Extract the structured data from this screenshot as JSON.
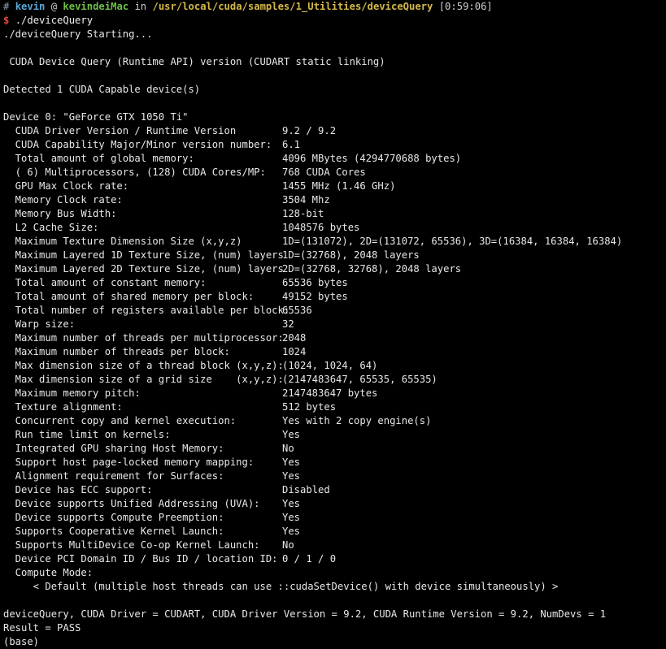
{
  "prompt": {
    "hash": "#",
    "user": "kevin",
    "at": "@",
    "host": "kevindeiMac",
    "in": "in",
    "path": "/usr/local/cuda/samples/1_Utilities/deviceQuery",
    "time": "[0:59:06]",
    "dollar": "$",
    "command": "./deviceQuery"
  },
  "header": {
    "starting": "./deviceQuery Starting...",
    "api_line": " CUDA Device Query (Runtime API) version (CUDART static linking)",
    "detected": "Detected 1 CUDA Capable device(s)",
    "device": "Device 0: \"GeForce GTX 1050 Ti\""
  },
  "properties": [
    {
      "key": "  CUDA Driver Version / Runtime Version",
      "value": "9.2 / 9.2"
    },
    {
      "key": "  CUDA Capability Major/Minor version number:",
      "value": "6.1"
    },
    {
      "key": "  Total amount of global memory:",
      "value": "4096 MBytes (4294770688 bytes)"
    },
    {
      "key": "  ( 6) Multiprocessors, (128) CUDA Cores/MP:",
      "value": "768 CUDA Cores"
    },
    {
      "key": "  GPU Max Clock rate:",
      "value": "1455 MHz (1.46 GHz)"
    },
    {
      "key": "  Memory Clock rate:",
      "value": "3504 Mhz"
    },
    {
      "key": "  Memory Bus Width:",
      "value": "128-bit"
    },
    {
      "key": "  L2 Cache Size:",
      "value": "1048576 bytes"
    },
    {
      "key": "  Maximum Texture Dimension Size (x,y,z)",
      "value": "1D=(131072), 2D=(131072, 65536), 3D=(16384, 16384, 16384)"
    },
    {
      "key": "  Maximum Layered 1D Texture Size, (num) layers",
      "value": "1D=(32768), 2048 layers"
    },
    {
      "key": "  Maximum Layered 2D Texture Size, (num) layers",
      "value": "2D=(32768, 32768), 2048 layers"
    },
    {
      "key": "  Total amount of constant memory:",
      "value": "65536 bytes"
    },
    {
      "key": "  Total amount of shared memory per block:",
      "value": "49152 bytes"
    },
    {
      "key": "  Total number of registers available per block:",
      "value": "65536"
    },
    {
      "key": "  Warp size:",
      "value": "32"
    },
    {
      "key": "  Maximum number of threads per multiprocessor:",
      "value": "2048"
    },
    {
      "key": "  Maximum number of threads per block:",
      "value": "1024"
    },
    {
      "key": "  Max dimension size of a thread block (x,y,z):",
      "value": "(1024, 1024, 64)"
    },
    {
      "key": "  Max dimension size of a grid size    (x,y,z):",
      "value": "(2147483647, 65535, 65535)"
    },
    {
      "key": "  Maximum memory pitch:",
      "value": "2147483647 bytes"
    },
    {
      "key": "  Texture alignment:",
      "value": "512 bytes"
    },
    {
      "key": "  Concurrent copy and kernel execution:",
      "value": "Yes with 2 copy engine(s)"
    },
    {
      "key": "  Run time limit on kernels:",
      "value": "Yes"
    },
    {
      "key": "  Integrated GPU sharing Host Memory:",
      "value": "No"
    },
    {
      "key": "  Support host page-locked memory mapping:",
      "value": "Yes"
    },
    {
      "key": "  Alignment requirement for Surfaces:",
      "value": "Yes"
    },
    {
      "key": "  Device has ECC support:",
      "value": "Disabled"
    },
    {
      "key": "  Device supports Unified Addressing (UVA):",
      "value": "Yes"
    },
    {
      "key": "  Device supports Compute Preemption:",
      "value": "Yes"
    },
    {
      "key": "  Supports Cooperative Kernel Launch:",
      "value": "Yes"
    },
    {
      "key": "  Supports MultiDevice Co-op Kernel Launch:",
      "value": "No"
    },
    {
      "key": "  Device PCI Domain ID / Bus ID / location ID:",
      "value": "0 / 1 / 0"
    }
  ],
  "compute_mode": {
    "label": "  Compute Mode:",
    "value": "     < Default (multiple host threads can use ::cudaSetDevice() with device simultaneously) >"
  },
  "footer": {
    "summary": "deviceQuery, CUDA Driver = CUDART, CUDA Driver Version = 9.2, CUDA Runtime Version = 9.2, NumDevs = 1",
    "result": "Result = PASS",
    "env": "(base)"
  },
  "colors": {
    "background": "#000000",
    "text": "#e8e8e8",
    "user": "#5aa8d8",
    "host": "#6fbf4a",
    "path": "#d4b84a",
    "dollar": "#e04a3a"
  }
}
